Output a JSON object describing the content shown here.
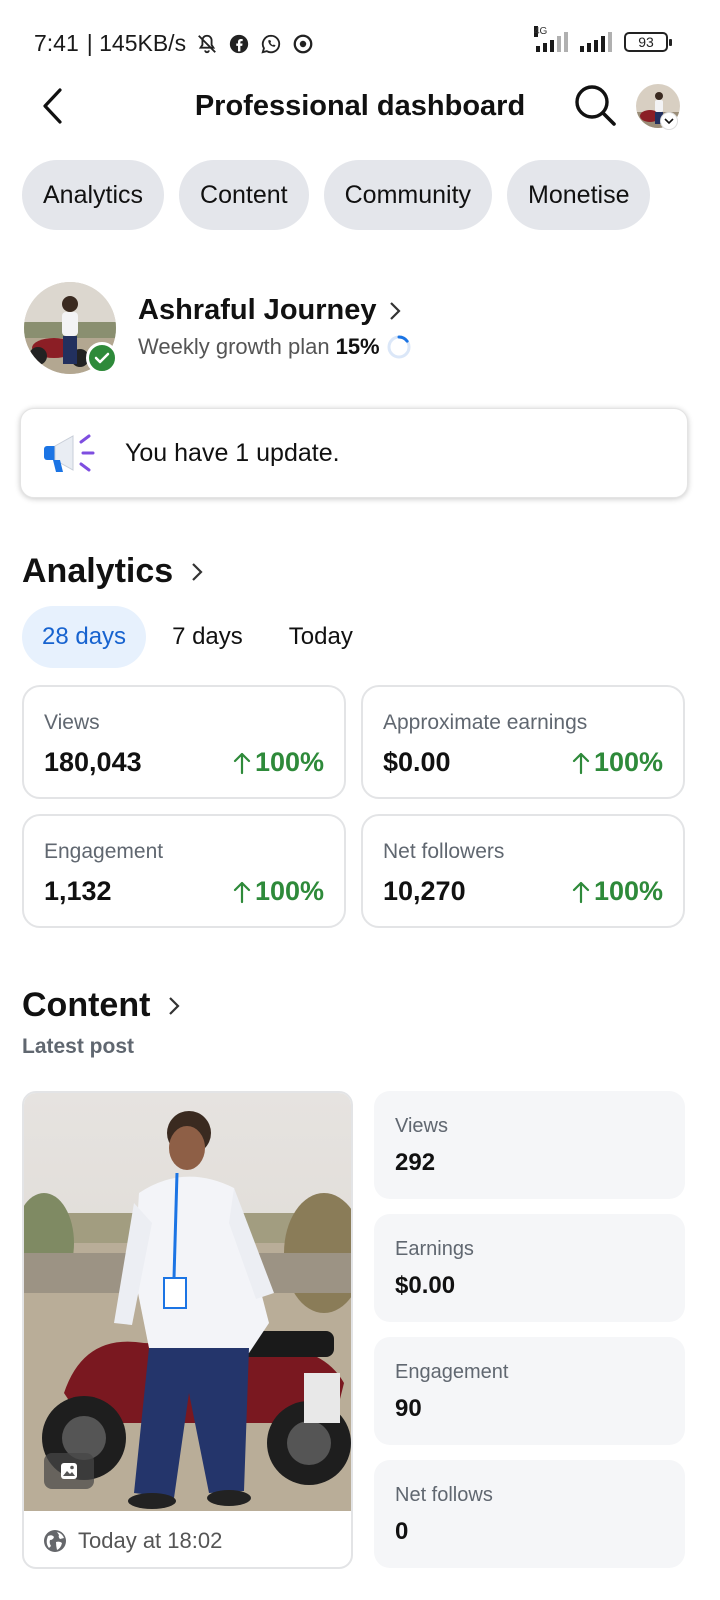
{
  "status_bar": {
    "time": "7:41",
    "speed": "| 145KB/s",
    "network": "4G",
    "battery": "93"
  },
  "header": {
    "title": "Professional dashboard"
  },
  "tabs": [
    {
      "label": "Analytics"
    },
    {
      "label": "Content"
    },
    {
      "label": "Community"
    },
    {
      "label": "Monetise"
    }
  ],
  "profile": {
    "name": "Ashraful Journey",
    "plan_label": "Weekly growth plan",
    "plan_percent": "15%",
    "plan_progress": 0.15
  },
  "update": {
    "text": "You have 1 update."
  },
  "analytics": {
    "title": "Analytics",
    "ranges": [
      {
        "label": "28 days",
        "active": true
      },
      {
        "label": "7 days",
        "active": false
      },
      {
        "label": "Today",
        "active": false
      }
    ],
    "stats": [
      {
        "label": "Views",
        "value": "180,043",
        "change": "100%"
      },
      {
        "label": "Approximate earnings",
        "value": "$0.00",
        "change": "100%"
      },
      {
        "label": "Engagement",
        "value": "1,132",
        "change": "100%"
      },
      {
        "label": "Net followers",
        "value": "10,270",
        "change": "100%"
      }
    ],
    "positive_color": "#2e8a3a"
  },
  "content": {
    "title": "Content",
    "subtitle": "Latest post",
    "post": {
      "timestamp": "Today at 18:02",
      "privacy_icon": "globe-icon",
      "type_icon": "photo-icon"
    },
    "metrics": [
      {
        "label": "Views",
        "value": "292"
      },
      {
        "label": "Earnings",
        "value": "$0.00"
      },
      {
        "label": "Engagement",
        "value": "90"
      },
      {
        "label": "Net follows",
        "value": "0"
      }
    ]
  },
  "colors": {
    "accent": "#1763cf",
    "accent_bg": "#e7f1fd",
    "chip_bg": "#e4e6eb",
    "verified": "#2e8a3a"
  }
}
